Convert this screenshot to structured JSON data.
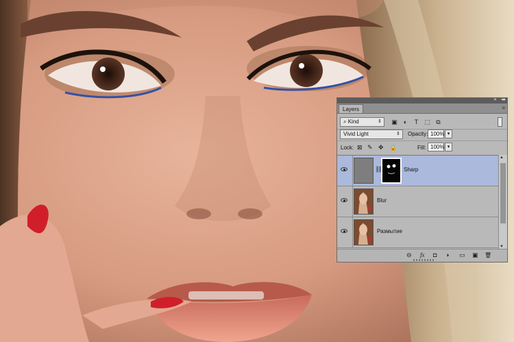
{
  "layers_panel": {
    "tab_label": "Layers",
    "filter": {
      "selected": "Kind"
    },
    "filter_icons": [
      "image-filter-icon",
      "adjustment-filter-icon",
      "type-filter-icon",
      "shape-filter-icon",
      "smart-object-filter-icon"
    ],
    "blend_mode": {
      "selected": "Vivid Light"
    },
    "opacity": {
      "label": "Opacity:",
      "value": "100%"
    },
    "lock": {
      "label": "Lock:",
      "icons": [
        "lock-transparent-icon",
        "lock-paint-icon",
        "lock-position-icon",
        "lock-all-icon"
      ]
    },
    "fill": {
      "label": "Fill:",
      "value": "100%"
    },
    "layers": [
      {
        "name": "Sharp",
        "selected": true,
        "visible": true,
        "has_mask": true
      },
      {
        "name": "Blur",
        "selected": false,
        "visible": true,
        "has_mask": false
      },
      {
        "name": "Размытие",
        "selected": false,
        "visible": true,
        "has_mask": false
      }
    ],
    "footer_icons": [
      "link-layers-icon",
      "layer-style-icon",
      "add-mask-icon",
      "adjustment-layer-icon",
      "new-group-icon",
      "new-layer-icon",
      "delete-layer-icon"
    ],
    "footer_glyphs": {
      "link": "⊖",
      "fx": "fx",
      "mask": "◘",
      "adjust": "◑",
      "group": "▭",
      "new": "▣",
      "trash": "🗑"
    }
  }
}
